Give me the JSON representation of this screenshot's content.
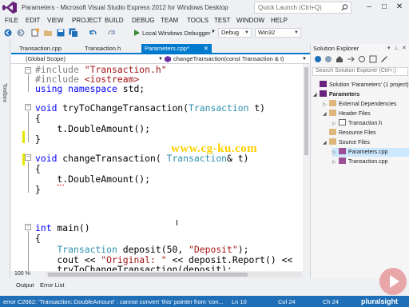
{
  "window": {
    "title": "Parameters - Microsoft Visual Studio Express 2012 for Windows Desktop",
    "quick_launch_placeholder": "Quick Launch (Ctrl+Q)",
    "minimize": "–",
    "restore": "□",
    "close": "✕"
  },
  "menu": [
    "FILE",
    "EDIT",
    "VIEW",
    "PROJECT",
    "BUILD",
    "DEBUG",
    "TEAM",
    "TOOLS",
    "TEST",
    "WINDOW",
    "HELP"
  ],
  "toolbar": {
    "debugger": "Local Windows Debugger",
    "config": "Debug",
    "platform": "Win32"
  },
  "toolbox_label": "Toolbox",
  "tabs": [
    "Transaction.cpp",
    "Transaction.h",
    "Parameters.cpp*"
  ],
  "navbar": {
    "scope": "(Global Scope)",
    "member": "changeTransaction(const Transaction & t)"
  },
  "code": [
    "#include \"Transaction.h\"",
    "#include <iostream>",
    "using namespace std;",
    "",
    "void tryToChangeTransaction(Transaction t)",
    "{",
    "    t.DoubleAmount();",
    "}",
    "",
    "void changeTransaction( Transaction& t)",
    "{",
    "    t.DoubleAmount();",
    "}",
    "",
    "",
    "int main()",
    "{",
    "    Transaction deposit(50, \"Deposit\");",
    "    cout << \"Original: \" << deposit.Report() <<",
    "    tryToChangeTransaction(deposit);"
  ],
  "watermark": "www.cg-ku.com",
  "zoom": "100 %",
  "solution_explorer": {
    "title": "Solution Explorer",
    "search_placeholder": "Search Solution Explorer (Ctrl+;)",
    "items": [
      {
        "label": "Solution 'Parameters' (1 project)",
        "level": 0,
        "icon": "solution-icon"
      },
      {
        "label": "Parameters",
        "level": 0,
        "icon": "project-icon",
        "bold": true
      },
      {
        "label": "External Dependencies",
        "level": 1,
        "icon": "folder-icon"
      },
      {
        "label": "Header Files",
        "level": 1,
        "icon": "folder-icon"
      },
      {
        "label": "Transaction.h",
        "level": 2,
        "icon": "header-file-icon"
      },
      {
        "label": "Resource Files",
        "level": 1,
        "icon": "folder-icon"
      },
      {
        "label": "Source Files",
        "level": 1,
        "icon": "folder-icon"
      },
      {
        "label": "Parameters.cpp",
        "level": 2,
        "icon": "cpp-file-icon",
        "selected": true
      },
      {
        "label": "Transaction.cpp",
        "level": 2,
        "icon": "cpp-file-icon"
      }
    ]
  },
  "bottom_tabs": [
    "Output",
    "Error List"
  ],
  "status": {
    "message": "error C2662: 'Transaction::DoubleAmount' : cannot convert 'this' pointer from 'con...",
    "line": "Ln 10",
    "col": "Col 24",
    "ch": "Ch 24"
  },
  "brand": "pluralsight",
  "colors": {
    "accent": "#007acc",
    "status_bar": "#1e6fb8",
    "keyword": "#0000ff",
    "string": "#a31515",
    "type": "#2b91af"
  }
}
